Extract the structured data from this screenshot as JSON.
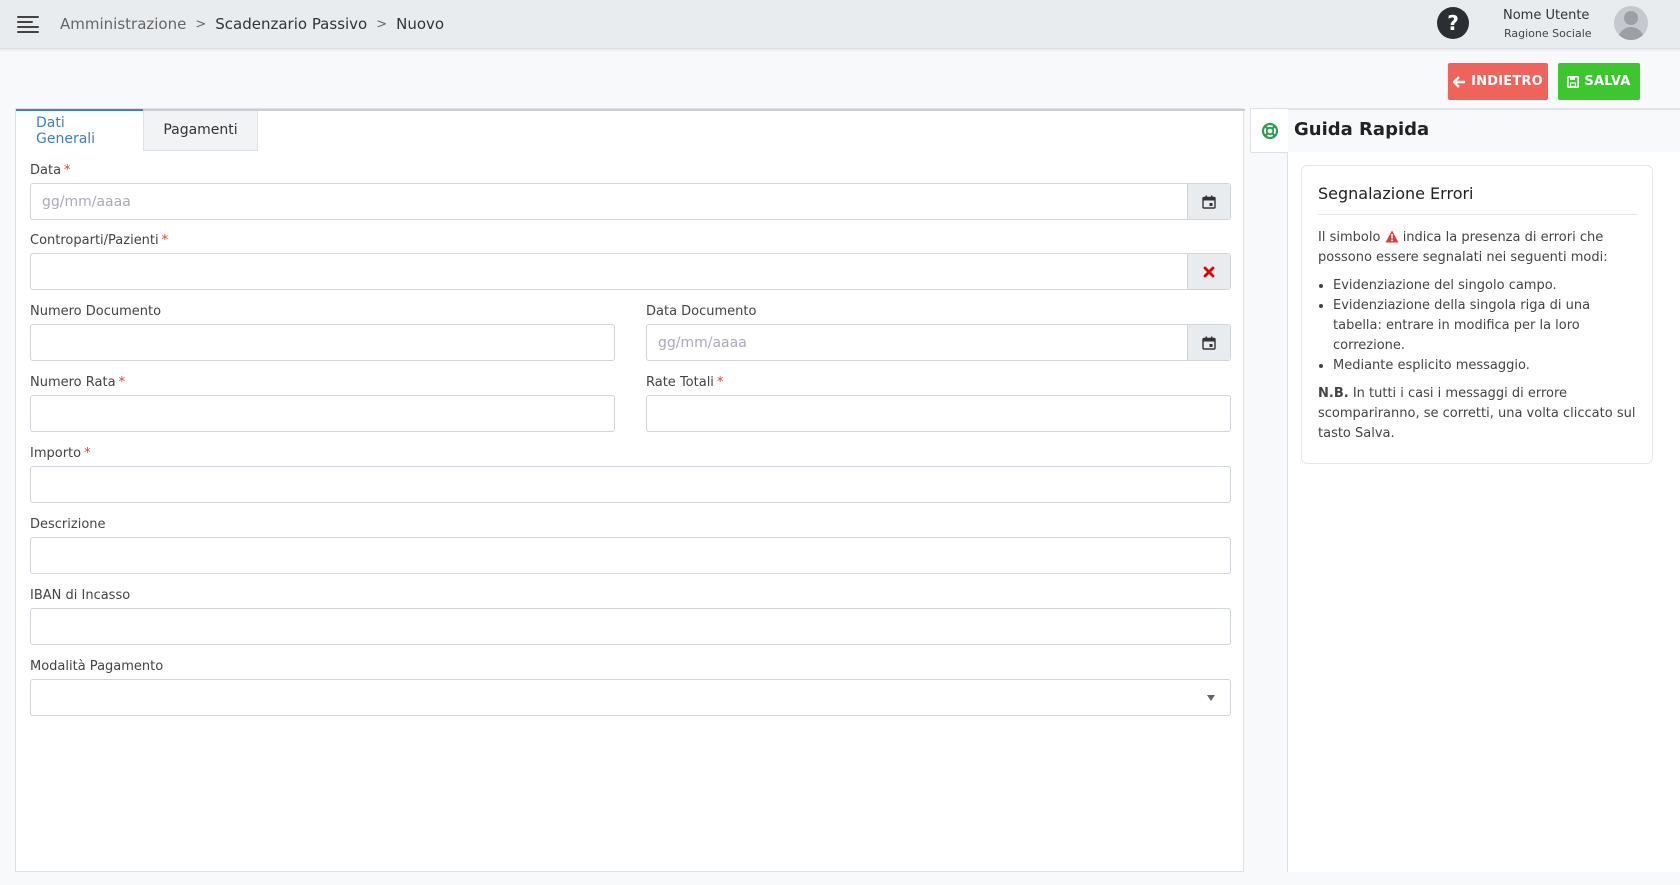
{
  "breadcrumb": {
    "items": [
      "Amministrazione",
      "Scadenzario Passivo",
      "Nuovo"
    ],
    "separator": ">"
  },
  "user": {
    "name": "Nome Utente",
    "company": "Ragione Sociale"
  },
  "help_icon": "question-circle",
  "actions": {
    "back_label": "INDIETRO",
    "save_label": "SALVA",
    "back_color": "#f0635a",
    "save_color": "#3cc72c"
  },
  "tabs": [
    {
      "label": "Dati Generali",
      "active": true
    },
    {
      "label": "Pagamenti",
      "active": false
    }
  ],
  "form": {
    "data": {
      "label": "Data",
      "required": "*",
      "placeholder": "gg/mm/aaaa"
    },
    "controparti": {
      "label": "Controparti/Pazienti",
      "required": "*",
      "value": ""
    },
    "numero_documento": {
      "label": "Numero Documento",
      "value": ""
    },
    "data_documento": {
      "label": "Data Documento",
      "placeholder": "gg/mm/aaaa"
    },
    "numero_rata": {
      "label": "Numero Rata",
      "required": "*",
      "value": ""
    },
    "rate_totali": {
      "label": "Rate Totali",
      "required": "*",
      "value": ""
    },
    "importo": {
      "label": "Importo",
      "required": "*",
      "value": ""
    },
    "descrizione": {
      "label": "Descrizione",
      "value": ""
    },
    "iban": {
      "label": "IBAN di Incasso",
      "value": ""
    },
    "modalita_pagamento": {
      "label": "Modalità Pagamento",
      "value": ""
    }
  },
  "guide": {
    "title": "Guida Rapida",
    "card_title": "Segnalazione Errori",
    "intro_before": "Il simbolo",
    "intro_after": "indica la presenza di errori che possono essere segnalati nei seguenti modi:",
    "items": [
      "Evidenziazione del singolo campo.",
      "Evidenziazione della singola riga di una tabella: entrare in modifica per la loro correzione.",
      "Mediante esplicito messaggio."
    ],
    "note_bold": "N.B.",
    "note_text": "In tutti i casi i messaggi di errore scompariranno, se corretti, una volta cliccato sul tasto Salva."
  },
  "colors": {
    "accent": "#3b82c4",
    "required": "#e53935",
    "guide_icon": "#2e9e4f",
    "clear_icon": "#e00000",
    "warning_icon": "#e53935"
  }
}
